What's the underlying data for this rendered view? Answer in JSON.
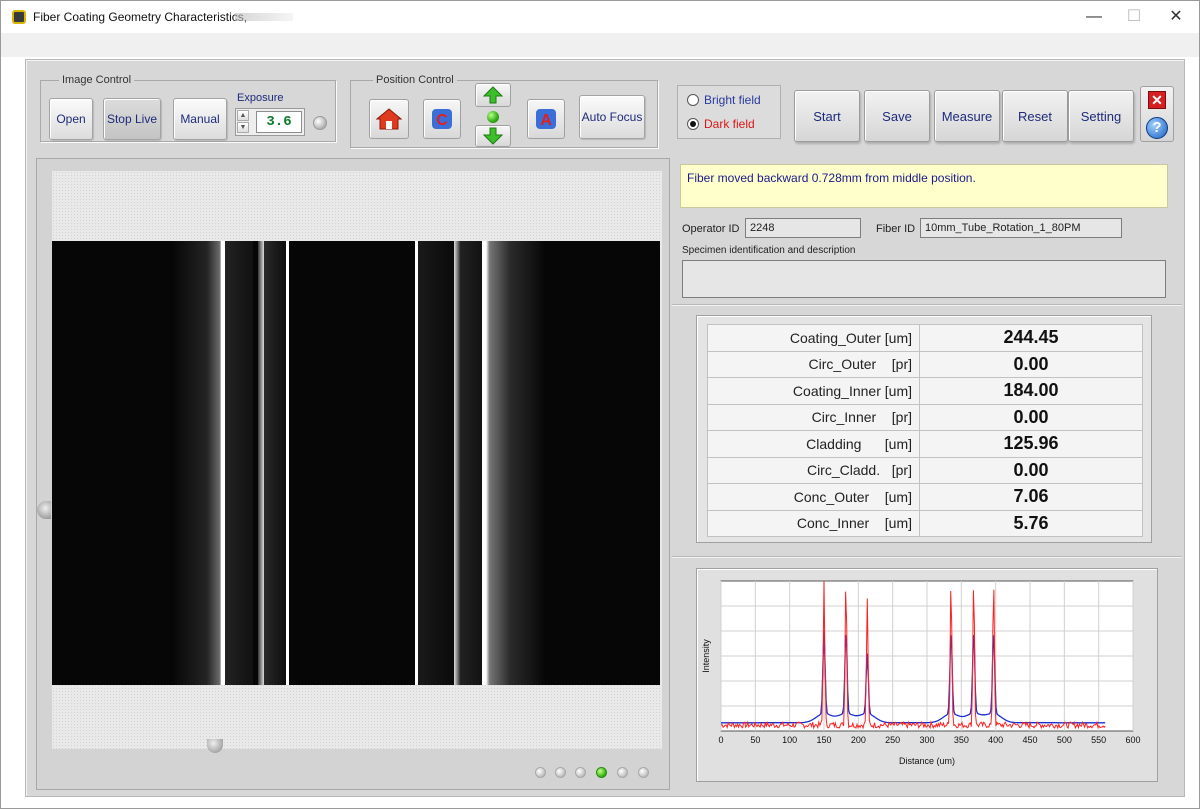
{
  "window": {
    "title": "Fiber Coating Geometry Characteristics,",
    "minimize": "—",
    "maximize": "☐",
    "close": "✕"
  },
  "image_control": {
    "group_label": "Image Control",
    "open": "Open",
    "stop_live": "Stop Live",
    "manual": "Manual",
    "exposure_label": "Exposure",
    "exposure_value": "3.6"
  },
  "position_control": {
    "group_label": "Position Control",
    "home_icon": "home-icon",
    "rotate_icon": "c-icon",
    "up_icon": "arrow-up-icon",
    "down_icon": "arrow-down-icon",
    "a_icon": "a-icon",
    "auto_focus": "Auto Focus"
  },
  "field_mode": {
    "bright": "Bright field",
    "dark": "Dark field",
    "selected": "dark"
  },
  "toolbar": {
    "start": "Start",
    "save": "Save",
    "measure": "Measure",
    "reset": "Reset",
    "setting": "Setting"
  },
  "status": {
    "message": "Fiber moved backward 0.728mm from middle position."
  },
  "ids": {
    "operator_label": "Operator ID",
    "operator_value": "2248",
    "fiber_label": "Fiber ID",
    "fiber_value": "10mm_Tube_Rotation_1_80PM",
    "specimen_label": "Specimen identification and description",
    "specimen_value": ""
  },
  "results": [
    {
      "label": "Coating_Outer [um]",
      "value": "244.45"
    },
    {
      "label": "Circ_Outer    [pr]",
      "value": "0.00"
    },
    {
      "label": "Coating_Inner [um]",
      "value": "184.00"
    },
    {
      "label": "Circ_Inner    [pr]",
      "value": "0.00"
    },
    {
      "label": "Cladding      [um]",
      "value": "125.96"
    },
    {
      "label": "Circ_Cladd.   [pr]",
      "value": "0.00"
    },
    {
      "label": "Conc_Outer    [um]",
      "value": "7.06"
    },
    {
      "label": "Conc_Inner    [um]",
      "value": "5.76"
    }
  ],
  "page_dots": {
    "count": 6,
    "active_index": 3
  },
  "colors": {
    "red_series": "#ff2020",
    "blue_series": "#1a2fd0",
    "status_bg": "#ffffcc",
    "exposure_text": "#0b7a2b"
  },
  "chart_data": {
    "type": "line",
    "xlabel": "Distance (um)",
    "ylabel": "Intensity",
    "xlim": [
      0,
      600
    ],
    "x_ticks": [
      0,
      50,
      100,
      150,
      200,
      250,
      300,
      350,
      400,
      450,
      500,
      550,
      600
    ],
    "grid": true,
    "series": [
      {
        "color": "red",
        "peaks": [
          [
            150,
            1.0
          ],
          [
            182,
            1.0
          ],
          [
            213,
            0.85
          ],
          [
            335,
            1.0
          ],
          [
            368,
            1.0
          ],
          [
            397,
            1.0
          ]
        ],
        "baseline": 0.02,
        "x_end": 560
      },
      {
        "color": "blue",
        "peaks": [
          [
            150,
            0.55
          ],
          [
            182,
            0.55
          ],
          [
            213,
            0.4
          ],
          [
            335,
            0.55
          ],
          [
            368,
            0.55
          ],
          [
            397,
            0.55
          ]
        ],
        "baseline": 0.05,
        "x_end": 560
      }
    ]
  }
}
